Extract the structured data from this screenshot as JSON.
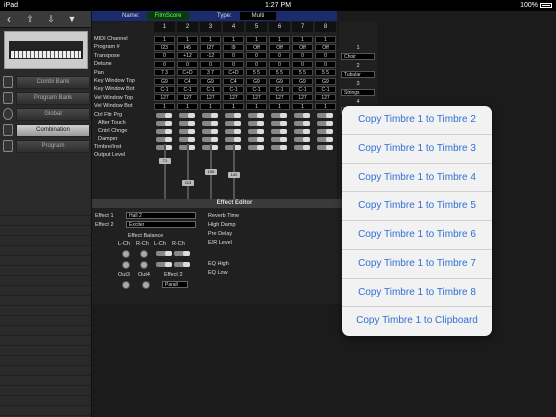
{
  "status": {
    "device": "iPad",
    "time": "1:27 PM",
    "battery": "100%"
  },
  "sidebar": {
    "banks": [
      "Combi Bank",
      "Program Bank",
      "Global",
      "Combination",
      "Program"
    ],
    "active_index": 3
  },
  "header": {
    "name_label": "Name:",
    "name_value": "FilmScore",
    "type_label": "Type:",
    "type_value": "Multi"
  },
  "grid": {
    "columns": [
      "1",
      "2",
      "3",
      "4",
      "5",
      "6",
      "7",
      "8"
    ],
    "rows": [
      {
        "label": "MIDI Channel",
        "values": [
          "1",
          "1",
          "1",
          "1",
          "1",
          "1",
          "1",
          "1"
        ]
      },
      {
        "label": "Program #",
        "values": [
          "I23",
          "I45",
          "I27",
          "I9",
          "Off",
          "Off",
          "Off",
          "Off"
        ]
      },
      {
        "label": "Transpose",
        "values": [
          "0",
          "+12",
          "-12",
          "0",
          "0",
          "0",
          "0",
          "0"
        ]
      },
      {
        "label": "Detune",
        "values": [
          "0",
          "0",
          "0",
          "0",
          "0",
          "0",
          "0",
          "0"
        ]
      },
      {
        "label": "Pan",
        "values": [
          "7 3",
          "C+D",
          "3 7",
          "C+D",
          "5 5",
          "5 5",
          "5 5",
          "5 5"
        ]
      },
      {
        "label": "Key Window Top",
        "values": [
          "G9",
          "C4",
          "G9",
          "C4",
          "G9",
          "G9",
          "G9",
          "G9"
        ]
      },
      {
        "label": "Key Window Bot",
        "values": [
          "C-1",
          "C-1",
          "C-1",
          "C-1",
          "C-1",
          "C-1",
          "C-1",
          "C-1"
        ]
      },
      {
        "label": "Vel Window Top",
        "values": [
          "127",
          "127",
          "127",
          "127",
          "127",
          "127",
          "127",
          "127"
        ]
      },
      {
        "label": "Vel Window Bot",
        "values": [
          "1",
          "1",
          "1",
          "1",
          "1",
          "1",
          "1",
          "1"
        ]
      }
    ],
    "switch_labels": [
      "Ctrl Fltr Prg",
      "After Touch",
      "Cntrl Chnge",
      "Damper",
      "Timbre/Inst"
    ],
    "output_label": "Output Level",
    "fader_values": [
      "71",
      "113",
      "100",
      "102"
    ]
  },
  "timbre_panel": [
    {
      "num": "1",
      "value": "Choir"
    },
    {
      "num": "2",
      "value": "Tubular"
    },
    {
      "num": "3",
      "value": "Strings"
    },
    {
      "num": "4",
      "value": ""
    }
  ],
  "effect": {
    "title": "Effect Editor",
    "effect1_label": "Effect 1",
    "effect1_value": "Hall 2",
    "effect2_label": "Effect 2",
    "effect2_value": "Exciter",
    "balance_label": "Effect Balance",
    "channels": [
      "L-Ch",
      "R-Ch",
      "L-Ch",
      "R-Ch"
    ],
    "outs": [
      "Out3",
      "Out4",
      "Effect 2"
    ],
    "effect2_mode": "Parall",
    "params": [
      "Reverb Time",
      "High Damp",
      "Pre Delay",
      "E/R Level",
      "EQ High",
      "EQ Low"
    ]
  },
  "popup": {
    "items": [
      "Copy Timbre 1 to Timbre 2",
      "Copy Timbre 1 to Timbre 3",
      "Copy Timbre 1 to Timbre 4",
      "Copy Timbre 1 to Timbre 5",
      "Copy Timbre 1 to Timbre 6",
      "Copy Timbre 1 to Timbre 7",
      "Copy Timbre 1 to Timbre 8",
      "Copy Timbre 1 to Clipboard"
    ]
  },
  "colors": {
    "accent": "#2f6fd6",
    "name_bar": "#1c2a6e"
  }
}
